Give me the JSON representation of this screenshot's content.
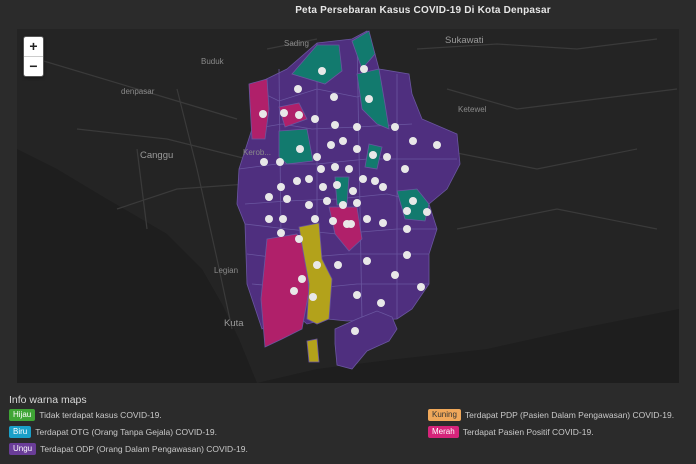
{
  "title": "Peta Persebaran Kasus COVID-19 Di Kota Denpasar",
  "zoom": {
    "in_label": "+",
    "out_label": "−"
  },
  "places": [
    {
      "id": "sading",
      "label": "Sading"
    },
    {
      "id": "sukawati",
      "label": "Sukawati"
    },
    {
      "id": "buduk",
      "label": "Buduk"
    },
    {
      "id": "denpasar",
      "label": "denpasar"
    },
    {
      "id": "canggu",
      "label": "Canggu"
    },
    {
      "id": "kerobokan",
      "label": "Kerob..."
    },
    {
      "id": "ketewel",
      "label": "Ketewel"
    },
    {
      "id": "legian",
      "label": "Legian"
    },
    {
      "id": "kuta",
      "label": "Kuta"
    }
  ],
  "legend": {
    "title": "Info warna maps",
    "items": [
      {
        "badge": "Hijau",
        "color": "#3fa535",
        "text": "Tidak terdapat kasus COVID-19."
      },
      {
        "badge": "Biru",
        "color": "#1aa0c8",
        "text": "Terdapat OTG (Orang Tanpa Gejala) COVID-19."
      },
      {
        "badge": "Ungu",
        "color": "#6a3d98",
        "text": "Terdapat ODP (Orang Dalam Pengawasan) COVID-19."
      },
      {
        "badge": "Kuning",
        "color": "#f0a85a",
        "text": "Terdapat PDP (Pasien Dalam Pengawasan) COVID-19."
      },
      {
        "badge": "Merah",
        "color": "#d6247a",
        "text": "Terdapat Pasien Positif COVID-19."
      }
    ]
  },
  "map_colors": {
    "purple": "#4f2f7f",
    "teal": "#127a6e",
    "magenta": "#b0206a",
    "yellow": "#b3a21b",
    "border": "#6a56a0"
  }
}
